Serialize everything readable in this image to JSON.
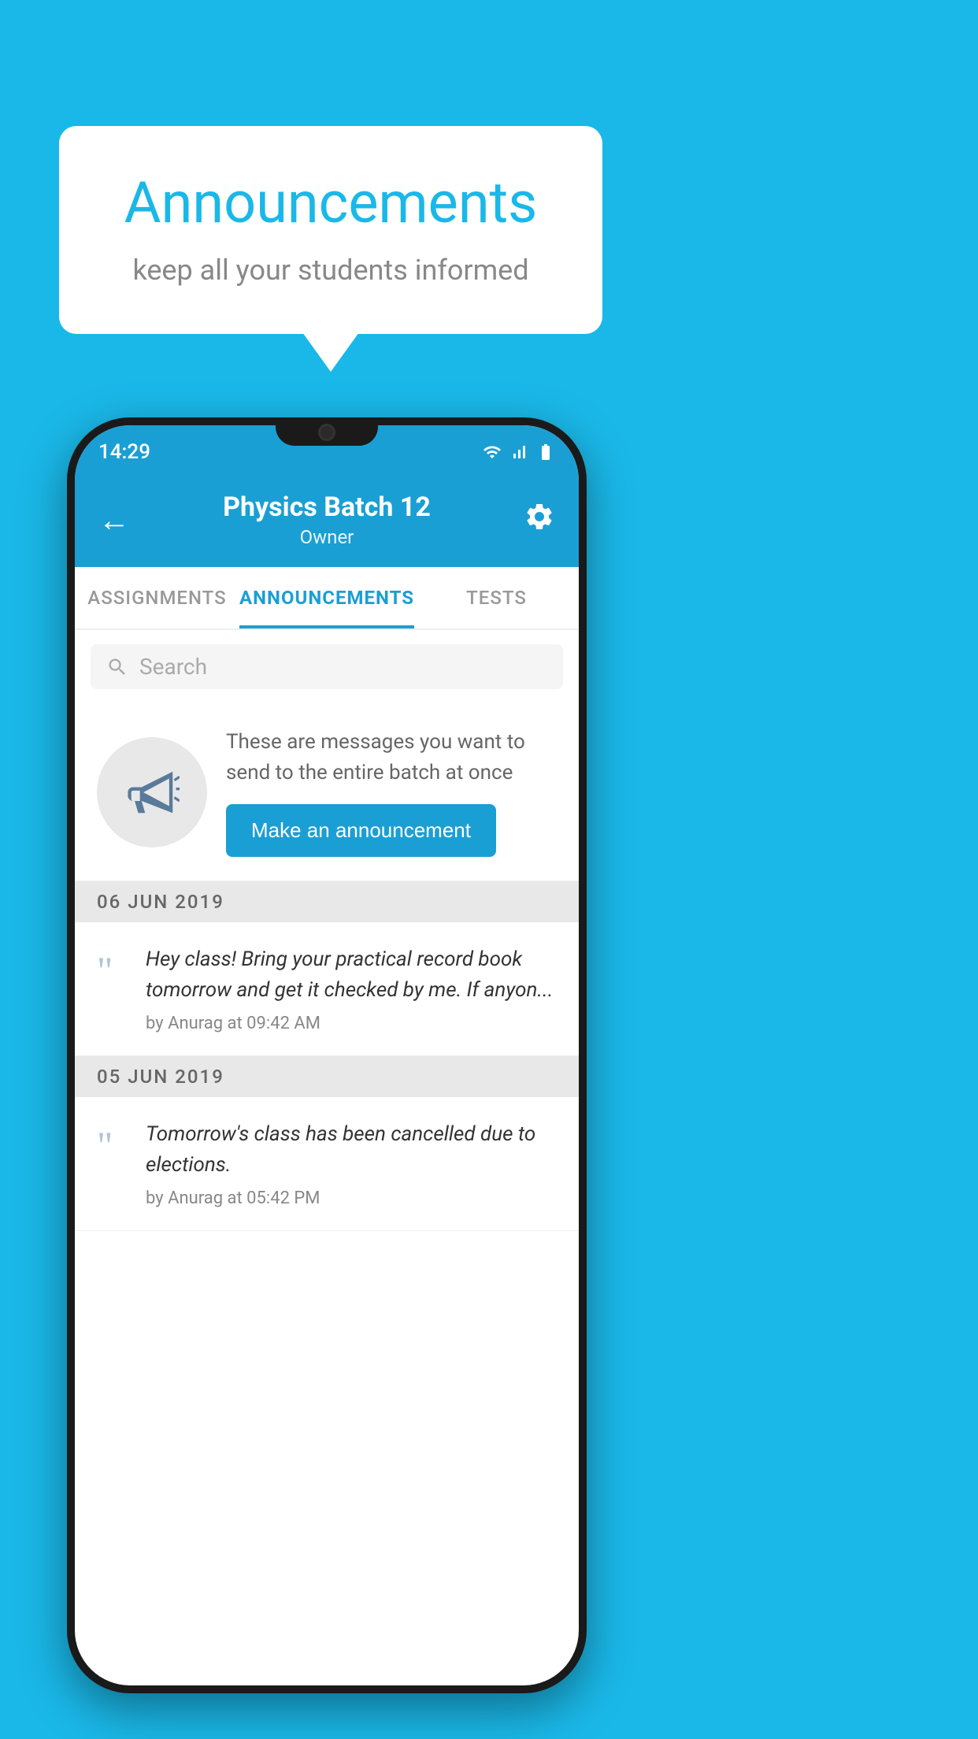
{
  "page": {
    "background_color": "#1ab8e8"
  },
  "speech_bubble": {
    "title": "Announcements",
    "subtitle": "keep all your students informed"
  },
  "status_bar": {
    "time": "14:29"
  },
  "header": {
    "title": "Physics Batch 12",
    "subtitle": "Owner",
    "back_label": "←",
    "settings_label": "⚙"
  },
  "tabs": [
    {
      "label": "ASSIGNMENTS",
      "active": false
    },
    {
      "label": "ANNOUNCEMENTS",
      "active": true
    },
    {
      "label": "TESTS",
      "active": false
    }
  ],
  "search": {
    "placeholder": "Search"
  },
  "promo": {
    "description": "These are messages you want to send to the entire batch at once",
    "button_label": "Make an announcement"
  },
  "announcements": [
    {
      "date": "06  JUN  2019",
      "text": "Hey class! Bring your practical record book tomorrow and get it checked by me. If anyon...",
      "meta": "by Anurag at 09:42 AM"
    },
    {
      "date": "05  JUN  2019",
      "text": "Tomorrow's class has been cancelled due to elections.",
      "meta": "by Anurag at 05:42 PM"
    }
  ]
}
